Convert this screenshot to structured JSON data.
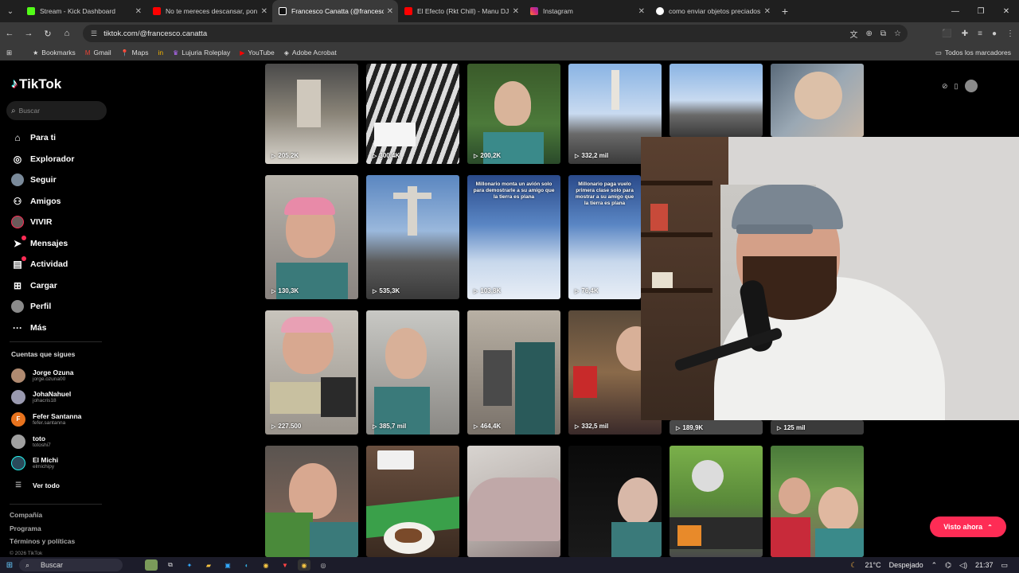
{
  "browser": {
    "tabs": [
      {
        "title": "Stream - Kick Dashboard",
        "icon": "kick-icon",
        "color": "#53fc18"
      },
      {
        "title": "No te mereces descansar, pon",
        "icon": "youtube-icon",
        "color": "#ff0000"
      },
      {
        "title": "Francesco Canatta (@francesco",
        "icon": "tiktok-icon",
        "color": "#ffffff",
        "active": true
      },
      {
        "title": "El Efecto (Rkt Chill) - Manu DJ -",
        "icon": "youtube-icon",
        "color": "#ff0000"
      },
      {
        "title": "Instagram",
        "icon": "instagram-icon",
        "color": "#e1306c"
      },
      {
        "title": "como enviar objetos preciados",
        "icon": "google-icon",
        "color": "#4285f4"
      }
    ],
    "url": "tiktok.com/@francesco.canatta",
    "bookmarks": [
      "Bookmarks",
      "Gmail",
      "Maps",
      "in",
      "Lujuria Roleplay",
      "YouTube",
      "Adobe Acrobat"
    ],
    "bookmarks_right": "Todos los marcadores"
  },
  "tiktok": {
    "logo": "TikTok",
    "search_placeholder": "Buscar",
    "nav": [
      {
        "label": "Para ti",
        "icon": "home-icon"
      },
      {
        "label": "Explorador",
        "icon": "compass-icon"
      },
      {
        "label": "Seguir",
        "icon": "avatar-icon"
      },
      {
        "label": "Amigos",
        "icon": "friends-icon"
      },
      {
        "label": "VIVIR",
        "icon": "live-icon"
      },
      {
        "label": "Mensajes",
        "icon": "messages-icon"
      },
      {
        "label": "Actividad",
        "icon": "activity-icon"
      },
      {
        "label": "Cargar",
        "icon": "upload-icon"
      },
      {
        "label": "Perfil",
        "icon": "profile-icon"
      },
      {
        "label": "Más",
        "icon": "more-icon"
      }
    ],
    "following_title": "Cuentas que sigues",
    "following": [
      {
        "name": "Jorge Ozuna",
        "user": "jorge.ozuna00"
      },
      {
        "name": "JohaNahuel",
        "user": "johacris18"
      },
      {
        "name": "Fefer Santanna",
        "user": "fefer.santanna",
        "initial": "F"
      },
      {
        "name": "toto",
        "user": "totoshi7"
      },
      {
        "name": "El Michi",
        "user": "elmichipy"
      }
    ],
    "see_all": "Ver todo",
    "footer": [
      "Compañía",
      "Programa",
      "Términos y políticas"
    ],
    "copyright": "© 2026 TikTok",
    "visto_ahora": "Visto ahora"
  },
  "videos": [
    {
      "count": "205,2K",
      "caption": ""
    },
    {
      "count": "300,4K",
      "caption": ""
    },
    {
      "count": "200,2K",
      "caption": ""
    },
    {
      "count": "332,2 mil",
      "caption": ""
    },
    {
      "count": "",
      "caption": ""
    },
    {
      "count": "",
      "caption": ""
    },
    {
      "count": "130,3K",
      "caption": ""
    },
    {
      "count": "535,3K",
      "caption": ""
    },
    {
      "count": "103,8K",
      "caption": "Millonario monta un avión solo para demostrarle a su amigo que la tierra es plana"
    },
    {
      "count": "76,4K",
      "caption": "Millonario paga vuelo primera clase solo para mostrar a su amigo que la tierra es plana"
    },
    {
      "count": "227.500",
      "caption": ""
    },
    {
      "count": "385,7 mil",
      "caption": ""
    },
    {
      "count": "464,4K",
      "caption": ""
    },
    {
      "count": "332,5 mil",
      "caption": ""
    },
    {
      "count": "189,9K",
      "caption": ""
    },
    {
      "count": "125 mil",
      "caption": ""
    },
    {
      "count": "",
      "caption": ""
    },
    {
      "count": "",
      "caption": ""
    },
    {
      "count": "",
      "caption": ""
    },
    {
      "count": "",
      "caption": ""
    },
    {
      "count": "",
      "caption": ""
    },
    {
      "count": "",
      "caption": ""
    }
  ],
  "taskbar": {
    "search": "Buscar",
    "weather": "21°C",
    "weather_text": "Despejado",
    "time": "21:37"
  }
}
